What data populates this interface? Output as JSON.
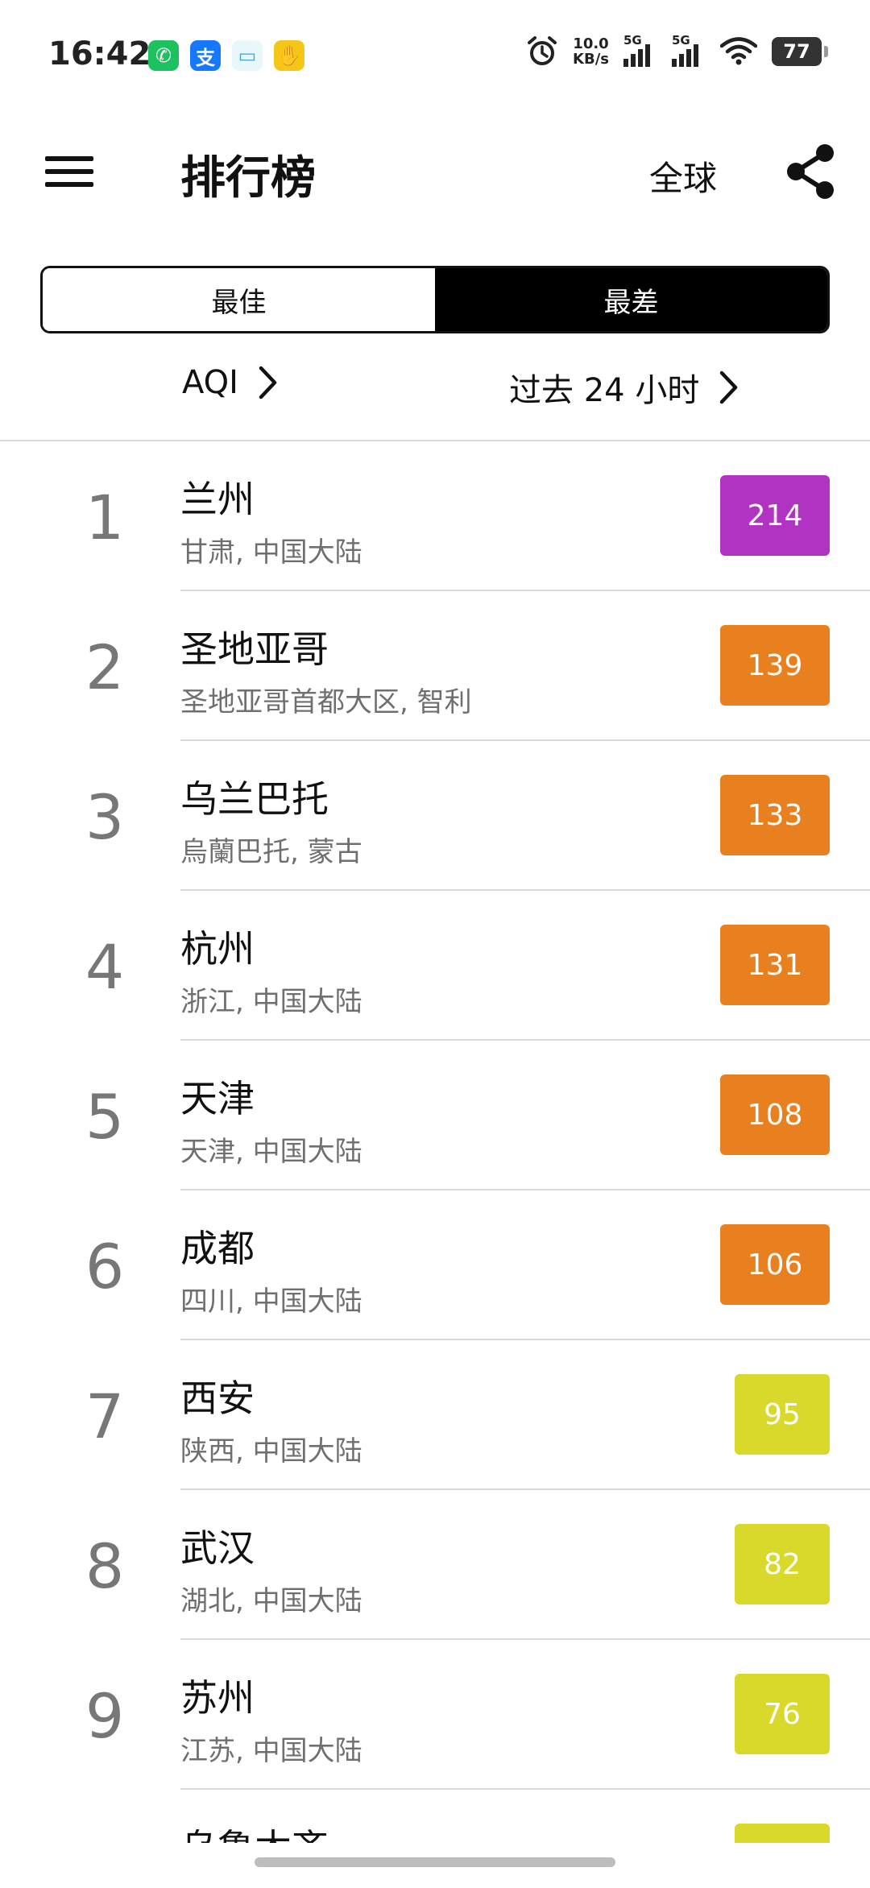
{
  "status_bar": {
    "time": "16:42",
    "app_icons": [
      {
        "name": "phone-app-icon",
        "glyph": "✆",
        "color": "#1ec15f"
      },
      {
        "name": "alipay-icon",
        "glyph": "支",
        "color": "#1677ff"
      },
      {
        "name": "message-app-icon",
        "glyph": "▭",
        "color": "#e7f7fb"
      },
      {
        "name": "hand-app-icon",
        "glyph": "✋",
        "color": "#f5c518"
      }
    ],
    "net_speed_value": "10.0",
    "net_speed_unit": "KB/s",
    "signal_1_label": "5G",
    "signal_2_label": "5G",
    "battery": "77"
  },
  "header": {
    "title": "排行榜",
    "region": "全球"
  },
  "tabs": [
    {
      "label": "最佳",
      "active": false
    },
    {
      "label": "最差",
      "active": true
    }
  ],
  "filters": {
    "metric": "AQI",
    "period": "过去 24 小时"
  },
  "ranking": [
    {
      "rank": "1",
      "city": "兰州",
      "region": "甘肃, 中国大陆",
      "aqi": "214",
      "color": "#b034c1"
    },
    {
      "rank": "2",
      "city": "圣地亚哥",
      "region": "圣地亚哥首都大区, 智利",
      "aqi": "139",
      "color": "#e8801f"
    },
    {
      "rank": "3",
      "city": "乌兰巴托",
      "region": "烏蘭巴托, 蒙古",
      "aqi": "133",
      "color": "#e8801f"
    },
    {
      "rank": "4",
      "city": "杭州",
      "region": "浙江, 中国大陆",
      "aqi": "131",
      "color": "#e8801f"
    },
    {
      "rank": "5",
      "city": "天津",
      "region": "天津, 中国大陆",
      "aqi": "108",
      "color": "#e8801f"
    },
    {
      "rank": "6",
      "city": "成都",
      "region": "四川, 中国大陆",
      "aqi": "106",
      "color": "#e8801f"
    },
    {
      "rank": "7",
      "city": "西安",
      "region": "陕西, 中国大陆",
      "aqi": "95",
      "color": "#d8d92a"
    },
    {
      "rank": "8",
      "city": "武汉",
      "region": "湖北, 中国大陆",
      "aqi": "82",
      "color": "#d8d92a"
    },
    {
      "rank": "9",
      "city": "苏州",
      "region": "江苏, 中国大陆",
      "aqi": "76",
      "color": "#d8d92a"
    },
    {
      "rank": "",
      "city": "乌鲁木齐",
      "region": "",
      "aqi": "",
      "color": "#d8d92a"
    }
  ]
}
